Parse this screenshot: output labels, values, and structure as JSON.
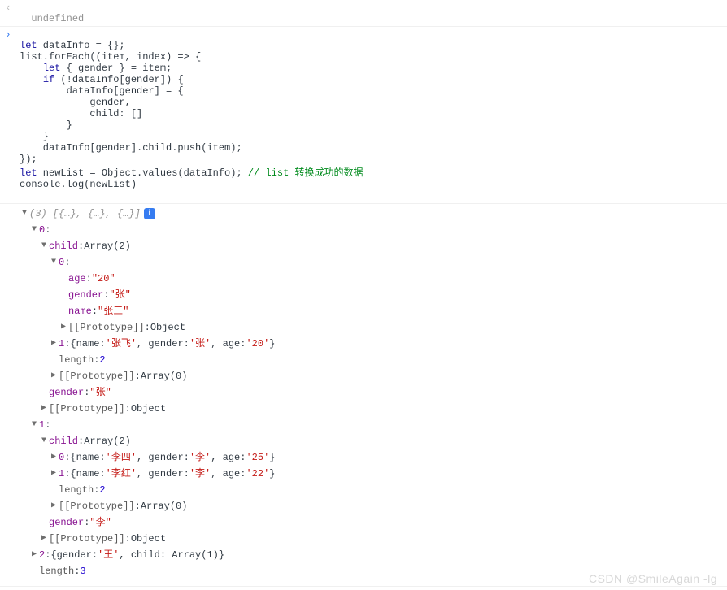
{
  "prev_output": "undefined",
  "code": {
    "l1a": "let",
    "l1b": " dataInfo = {};",
    "l2a": "list.forEach((item, index) => {",
    "l3a": "    ",
    "l3b": "let",
    "l3c": " { gender } = item;",
    "l4a": "    ",
    "l4b": "if",
    "l4c": " (!dataInfo[gender]) {",
    "l5": "        dataInfo[gender] = {",
    "l6": "            gender,",
    "l7": "            child: []",
    "l8": "        }",
    "l9": "    }",
    "l10": "    dataInfo[gender].child.push(item);",
    "l11": "});",
    "l12a": "let",
    "l12b": " newList = Object.values(dataInfo); ",
    "l12c": "// list 转换成功的数据",
    "l13": "console.log(newList)"
  },
  "log": {
    "summary": "(3) [{…}, {…}, {…}]",
    "idx0": "0",
    "item0": {
      "childLabel": "child",
      "childType": "Array(2)",
      "c0idx": "0",
      "c0": {
        "ageK": "age",
        "ageV": "\"20\"",
        "genderK": "gender",
        "genderV": "\"张\"",
        "nameK": "name",
        "nameV": "\"张三\""
      },
      "c0proto": "[[Prototype]]",
      "c0protoV": "Object",
      "c1idx": "1",
      "c1text_a": "{name: ",
      "c1name": "'张飞'",
      "c1text_b": ", gender: ",
      "c1gender": "'张'",
      "c1text_c": ", age: ",
      "c1age": "'20'",
      "c1text_d": "}",
      "lenK": "length",
      "lenV": "2",
      "protoK": "[[Prototype]]",
      "protoV": "Array(0)",
      "genderK": "gender",
      "genderV": "\"张\""
    },
    "item0protoK": "[[Prototype]]",
    "item0protoV": "Object",
    "idx1": "1",
    "item1": {
      "childLabel": "child",
      "childType": "Array(2)",
      "c0idx": "0",
      "c0_a": "{name: ",
      "c0name": "'李四'",
      "c0_b": ", gender: ",
      "c0gender": "'李'",
      "c0_c": ", age: ",
      "c0age": "'25'",
      "c0_d": "}",
      "c1idx": "1",
      "c1_a": "{name: ",
      "c1name": "'李红'",
      "c1_b": ", gender: ",
      "c1gender": "'李'",
      "c1_c": ", age: ",
      "c1age": "'22'",
      "c1_d": "}",
      "lenK": "length",
      "lenV": "2",
      "protoK": "[[Prototype]]",
      "protoV": "Array(0)",
      "genderK": "gender",
      "genderV": "\"李\""
    },
    "item1protoK": "[[Prototype]]",
    "item1protoV": "Object",
    "idx2": "2",
    "item2_a": "{gender: ",
    "item2gender": "'王'",
    "item2_b": ", child: Array(1)}",
    "lenK": "length",
    "lenV": "3"
  },
  "info_badge": "i",
  "watermark": "CSDN @SmileAgain -lg"
}
